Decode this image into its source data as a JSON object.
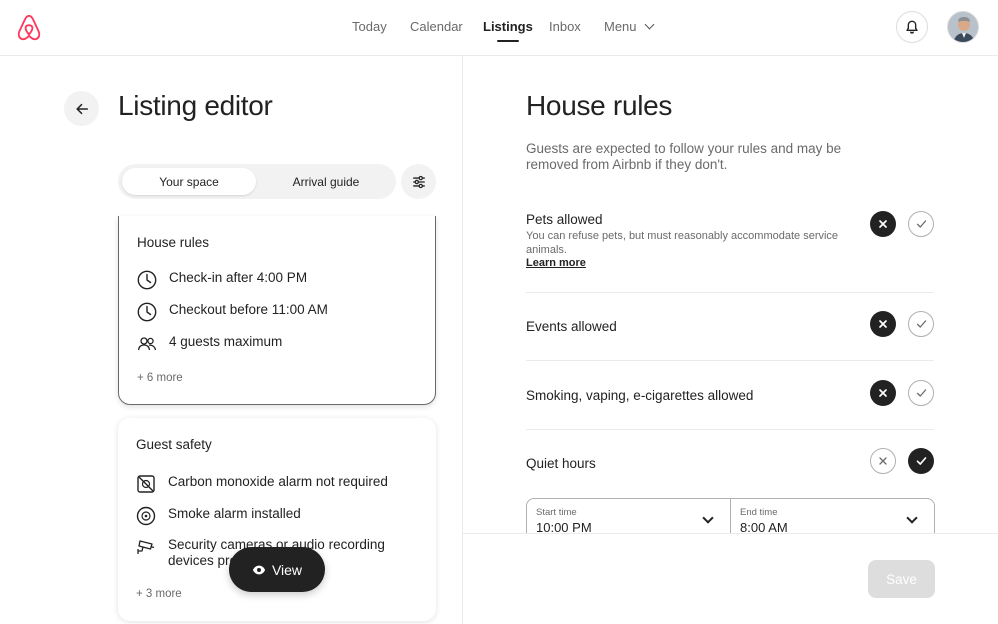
{
  "brand": {
    "logo_icon": "airbnb-logo-icon",
    "accent": "#FF385C"
  },
  "nav": {
    "items": [
      {
        "label": "Today"
      },
      {
        "label": "Calendar"
      },
      {
        "label": "Listings",
        "active": true
      },
      {
        "label": "Inbox"
      },
      {
        "label": "Menu"
      }
    ]
  },
  "header_icons": {
    "notifications": "bell-icon",
    "profile": "avatar"
  },
  "editor": {
    "title": "Listing editor",
    "tabs": [
      {
        "label": "Your space",
        "selected": true
      },
      {
        "label": "Arrival guide",
        "selected": false
      }
    ],
    "filter_icon": "sliders-icon"
  },
  "cards": {
    "house_rules": {
      "title": "House rules",
      "rows": [
        {
          "icon": "clock-icon",
          "text": "Check-in after 4:00 PM"
        },
        {
          "icon": "clock-icon",
          "text": "Checkout before 11:00 AM"
        },
        {
          "icon": "guests-icon",
          "text": "4 guests maximum"
        }
      ],
      "more": "+ 6 more"
    },
    "guest_safety": {
      "title": "Guest safety",
      "rows": [
        {
          "icon": "co-alarm-off-icon",
          "text": "Carbon monoxide alarm not required"
        },
        {
          "icon": "smoke-alarm-icon",
          "text": "Smoke alarm installed"
        },
        {
          "icon": "security-camera-icon",
          "text": "Security cameras or audio recording devices present"
        }
      ],
      "more": "+ 3 more"
    }
  },
  "view_button": {
    "label": "View",
    "icon": "eye-icon"
  },
  "house_rules_panel": {
    "title": "House rules",
    "description": "Guests are expected to follow your rules and may be removed from Airbnb if they don't.",
    "rules": [
      {
        "label": "Pets allowed",
        "sub": "You can refuse pets, but must reasonably accommodate service animals.",
        "link": "Learn more",
        "value": "no"
      },
      {
        "label": "Events allowed",
        "value": "no"
      },
      {
        "label": "Smoking, vaping, e-cigarettes allowed",
        "value": "no"
      },
      {
        "label": "Quiet hours",
        "value": "yes"
      }
    ],
    "quiet_hours": {
      "start": {
        "label": "Start time",
        "value": "10:00 PM"
      },
      "end": {
        "label": "End time",
        "value": "8:00 AM"
      }
    }
  },
  "footer": {
    "save_label": "Save"
  }
}
